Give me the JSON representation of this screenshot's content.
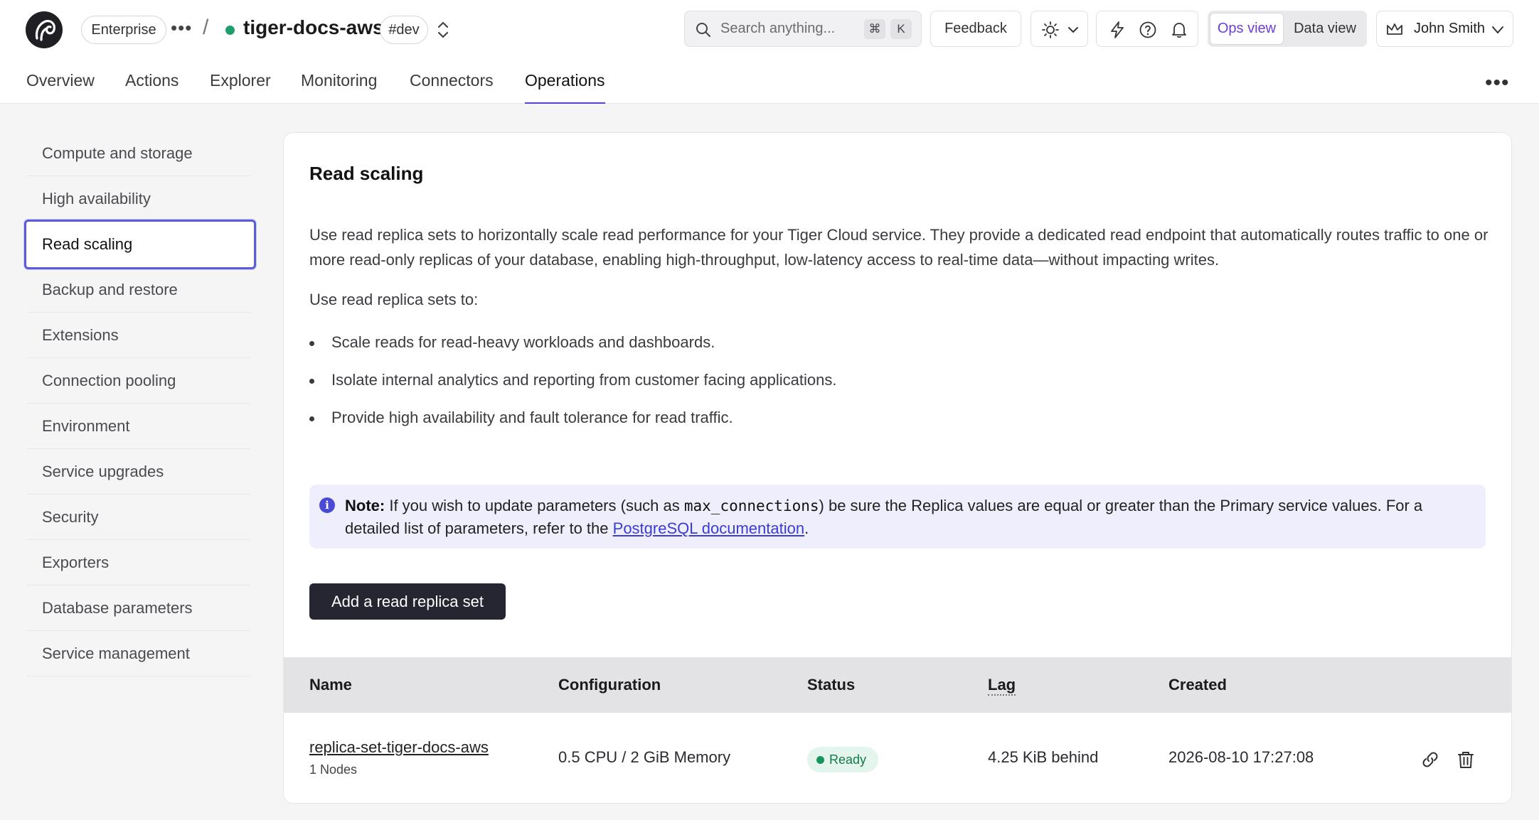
{
  "header": {
    "org_badge": "Enterprise",
    "service_name": "tiger-docs-aws",
    "env_badge": "#dev",
    "search_placeholder": "Search anything...",
    "search_kbd_1": "⌘",
    "search_kbd_2": "K",
    "feedback_label": "Feedback",
    "ops_view_label": "Ops view",
    "data_view_label": "Data view",
    "user_name": "John Smith"
  },
  "tabs": [
    {
      "label": "Overview"
    },
    {
      "label": "Actions"
    },
    {
      "label": "Explorer"
    },
    {
      "label": "Monitoring"
    },
    {
      "label": "Connectors"
    },
    {
      "label": "Operations",
      "active": true
    }
  ],
  "sidebar": {
    "items": [
      {
        "label": "Compute and storage"
      },
      {
        "label": "High availability"
      },
      {
        "label": "Read scaling",
        "active": true
      },
      {
        "label": "Backup and restore"
      },
      {
        "label": "Extensions"
      },
      {
        "label": "Connection pooling"
      },
      {
        "label": "Environment"
      },
      {
        "label": "Service upgrades"
      },
      {
        "label": "Security"
      },
      {
        "label": "Exporters"
      },
      {
        "label": "Database parameters"
      },
      {
        "label": "Service management"
      }
    ]
  },
  "main": {
    "title": "Read scaling",
    "description": "Use read replica sets to horizontally scale read performance for your Tiger Cloud service. They provide a dedicated read endpoint that automatically routes traffic to one or more read-only replicas of your database, enabling high-throughput, low-latency access to real-time data—without impacting writes.",
    "lead": "Use read replica sets to:",
    "bullets": [
      "Scale reads for read-heavy workloads and dashboards.",
      "Isolate internal analytics and reporting from customer facing applications.",
      "Provide high availability and fault tolerance for read traffic."
    ],
    "note": {
      "label": "Note:",
      "text_1": " If you wish to update parameters (such as ",
      "code": "max_connections",
      "text_2": ") be sure the Replica values are equal or greater than the Primary service values. For a detailed list of parameters, refer to the ",
      "link": "PostgreSQL documentation",
      "text_3": "."
    },
    "add_button": "Add a read replica set",
    "table": {
      "columns": [
        "Name",
        "Configuration",
        "Status",
        "Lag",
        "Created"
      ],
      "rows": [
        {
          "name": "replica-set-tiger-docs-aws",
          "nodes": "1 Nodes",
          "configuration": "0.5 CPU / 2 GiB Memory",
          "status": "Ready",
          "lag": "4.25 KiB behind",
          "created": "2026-08-10 17:27:08"
        }
      ]
    }
  },
  "colors": {
    "accent": "#5b3fd6",
    "ready": "#15955b",
    "primary_button": "#262633"
  }
}
